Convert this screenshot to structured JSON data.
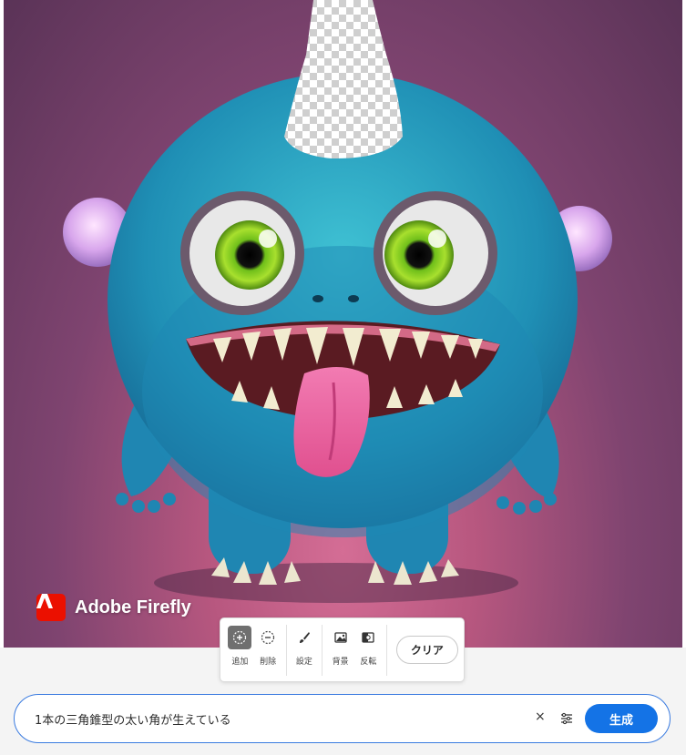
{
  "canvas": {
    "subject": "fluffy-blue-monster-image",
    "watermark_text": "Adobe Firefly"
  },
  "toolbar": {
    "tools": [
      {
        "label": "追加",
        "icon": "add-brush-icon",
        "active": true
      },
      {
        "label": "削除",
        "icon": "subtract-brush-icon",
        "active": false
      },
      {
        "label": "設定",
        "icon": "brush-settings-icon",
        "active": false
      },
      {
        "label": "背景",
        "icon": "background-icon",
        "active": false
      },
      {
        "label": "反転",
        "icon": "invert-icon",
        "active": false
      }
    ],
    "clear_label": "クリア"
  },
  "prompt": {
    "value": "1本の三角錐型の太い角が生えている",
    "clear_symbol": "×",
    "generate_label": "生成"
  },
  "colors": {
    "accent": "#1473e6",
    "prompt_border": "#3a7be0",
    "firefly_red": "#eb1000"
  }
}
